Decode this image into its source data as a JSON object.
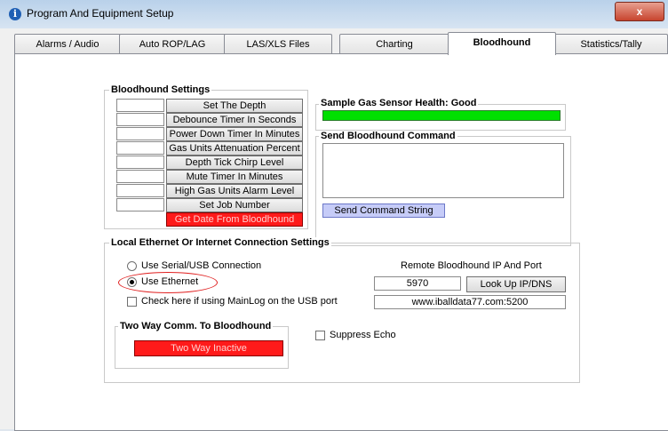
{
  "window": {
    "title": "Program And Equipment Setup",
    "close_glyph": "x"
  },
  "tabs": [
    "Alarms / Audio",
    "Auto ROP/LAG",
    "LAS/XLS Files",
    "Charting",
    "Bloodhound",
    "Statistics/Tally"
  ],
  "bloodhound_settings": {
    "title": "Bloodhound Settings",
    "buttons": [
      "Set The Depth",
      "Debounce Timer In Seconds",
      "Power Down Timer In Minutes",
      "Gas Units Attenuation Percent",
      "Depth Tick Chirp Level",
      "Mute Timer In Minutes",
      "High Gas Units Alarm Level",
      "Set Job Number"
    ],
    "date_button": "Get Date From Bloodhound"
  },
  "sensor": {
    "title": "Sample Gas Sensor Health: Good",
    "health_fraction": 1.0,
    "bar_color": "#00e000"
  },
  "send_command": {
    "title": "Send Bloodhound Command",
    "button": "Send Command String"
  },
  "ethernet": {
    "title": "Local Ethernet Or Internet Connection Settings",
    "radio_serial": "Use Serial/USB Connection",
    "radio_ethernet": "Use Ethernet",
    "check_mainlog": "Check here if using MainLog on the USB port",
    "remote_label": "Remote Bloodhound IP And Port",
    "port": "5970",
    "lookup_button": "Look Up IP/DNS",
    "address": "www.iballdata77.com:5200"
  },
  "twoway": {
    "title": "Two Way Comm. To Bloodhound",
    "button": "Two Way Inactive"
  },
  "suppress_echo": "Suppress Echo"
}
